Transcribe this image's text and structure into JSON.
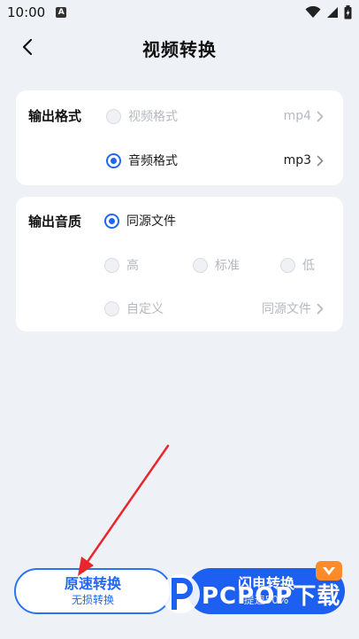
{
  "status_bar": {
    "time": "10:00",
    "notification_letter": "A"
  },
  "header": {
    "title": "视频转换",
    "back_icon": "chevron-left-icon"
  },
  "output_format": {
    "label": "输出格式",
    "options": [
      {
        "label": "视频格式",
        "value": "mp4",
        "selected": false
      },
      {
        "label": "音频格式",
        "value": "mp3",
        "selected": true
      }
    ]
  },
  "output_quality": {
    "label": "输出音质",
    "source_option": {
      "label": "同源文件",
      "selected": true
    },
    "levels": [
      {
        "label": "高",
        "selected": false
      },
      {
        "label": "标准",
        "selected": false
      },
      {
        "label": "低",
        "selected": false
      }
    ],
    "custom": {
      "label": "自定义",
      "value": "同源文件",
      "selected": false
    }
  },
  "actions": {
    "original": {
      "title": "原速转换",
      "subtitle": "无损转换"
    },
    "flash": {
      "title": "闪电转换",
      "subtitle": "提速50%",
      "badge_icon": "vip-crown-icon"
    }
  },
  "watermark": {
    "text": "PCPOP下载"
  },
  "colors": {
    "accent": "#2266f2",
    "background": "#eef1f6",
    "disabled_text": "#b5b8be",
    "badge": "#ff8a2a",
    "annotation_arrow": "#e8262b"
  }
}
